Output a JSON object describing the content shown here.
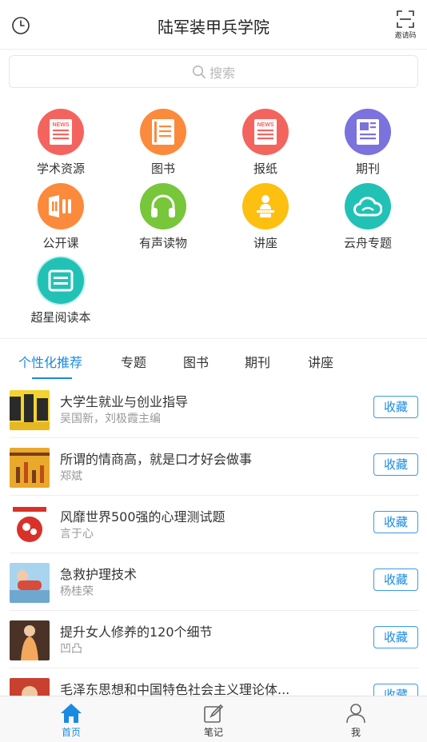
{
  "header": {
    "title": "陆军装甲兵学院",
    "invite_label": "邀请码"
  },
  "search": {
    "placeholder": "搜索"
  },
  "categories": [
    {
      "label": "学术资源",
      "color": "#f4645f",
      "icon": "news-icon"
    },
    {
      "label": "图书",
      "color": "#fb8a3c",
      "icon": "book-icon"
    },
    {
      "label": "报纸",
      "color": "#f4645f",
      "icon": "newspaper-icon"
    },
    {
      "label": "期刊",
      "color": "#7b72dd",
      "icon": "journal-icon"
    },
    {
      "label": "公开课",
      "color": "#fb8a3c",
      "icon": "open-course-icon"
    },
    {
      "label": "有声读物",
      "color": "#78c63a",
      "icon": "headphones-icon"
    },
    {
      "label": "讲座",
      "color": "#fdbf10",
      "icon": "lecture-icon"
    },
    {
      "label": "云舟专题",
      "color": "#22c1b6",
      "icon": "cloud-icon"
    },
    {
      "label": "超星阅读本",
      "color": "#22c1b6",
      "icon": "reader-icon"
    }
  ],
  "tabs": [
    {
      "label": "个性化推荐",
      "active": true
    },
    {
      "label": "专题",
      "active": false
    },
    {
      "label": "图书",
      "active": false
    },
    {
      "label": "期刊",
      "active": false
    },
    {
      "label": "讲座",
      "active": false
    }
  ],
  "books": [
    {
      "title": "大学生就业与创业指导",
      "author": "吴国新，刘极霞主编",
      "action": "收藏"
    },
    {
      "title": "所谓的情商高，就是口才好会做事",
      "author": "郑斌",
      "action": "收藏"
    },
    {
      "title": "风靡世界500强的心理测试题",
      "author": "言于心",
      "action": "收藏"
    },
    {
      "title": "急救护理技术",
      "author": "杨桂荣",
      "action": "收藏"
    },
    {
      "title": "提升女人修养的120个细节",
      "author": "凹凸",
      "action": "收藏"
    },
    {
      "title": "毛泽东思想和中国特色社会主义理论体...",
      "author": "",
      "action": "收藏"
    }
  ],
  "tabbar": [
    {
      "label": "首页",
      "active": true,
      "icon": "home-icon"
    },
    {
      "label": "笔记",
      "active": false,
      "icon": "note-icon"
    },
    {
      "label": "我",
      "active": false,
      "icon": "profile-icon"
    }
  ],
  "colors": {
    "accent": "#1a8be0"
  }
}
